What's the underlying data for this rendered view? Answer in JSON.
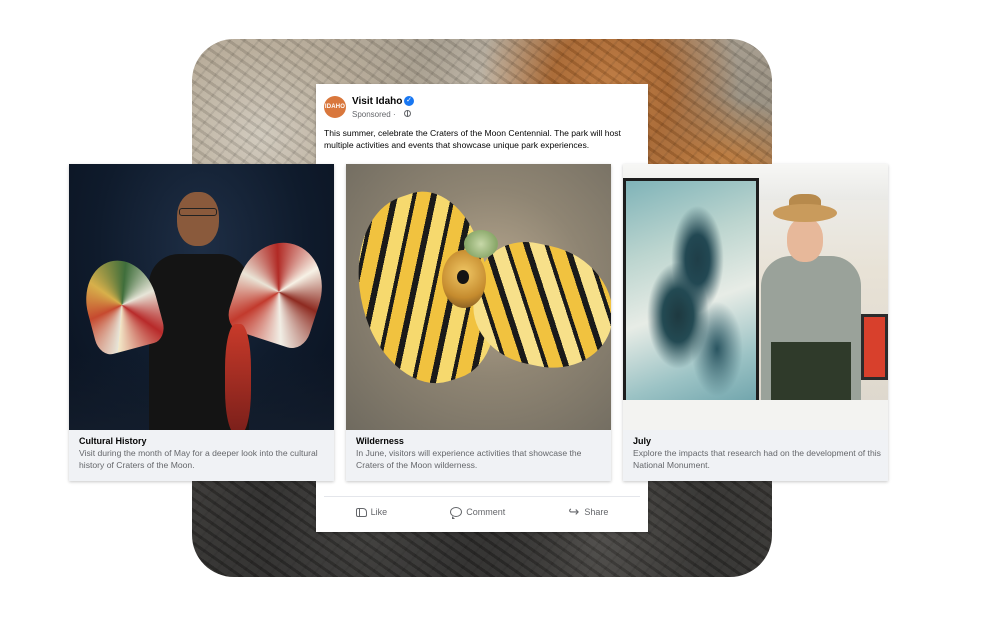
{
  "post": {
    "page_name": "Visit Idaho",
    "avatar_text": "IDAHO",
    "verified_icon": "verified-badge-icon",
    "sponsored_label": "Sponsored",
    "sponsored_separator": "·",
    "text": "This summer, celebrate the Craters of the Moon Centennial. The park will host multiple activities and events that showcase unique park experiences."
  },
  "cards": [
    {
      "title": "Cultural History",
      "description": "Visit during the month of May for a deeper look into the cultural history of Craters of the Moon."
    },
    {
      "title": "Wilderness",
      "description": "In June, visitors will experience activities that showcase the Craters of the Moon wilderness."
    },
    {
      "title": "July",
      "description": "Explore the impacts that research had on the development of this National Monument."
    }
  ],
  "actions": {
    "like": "Like",
    "comment": "Comment",
    "share": "Share"
  },
  "colors": {
    "brand_accent": "#1877f2",
    "avatar": "#d9773c",
    "card_bg": "#f0f2f5"
  }
}
